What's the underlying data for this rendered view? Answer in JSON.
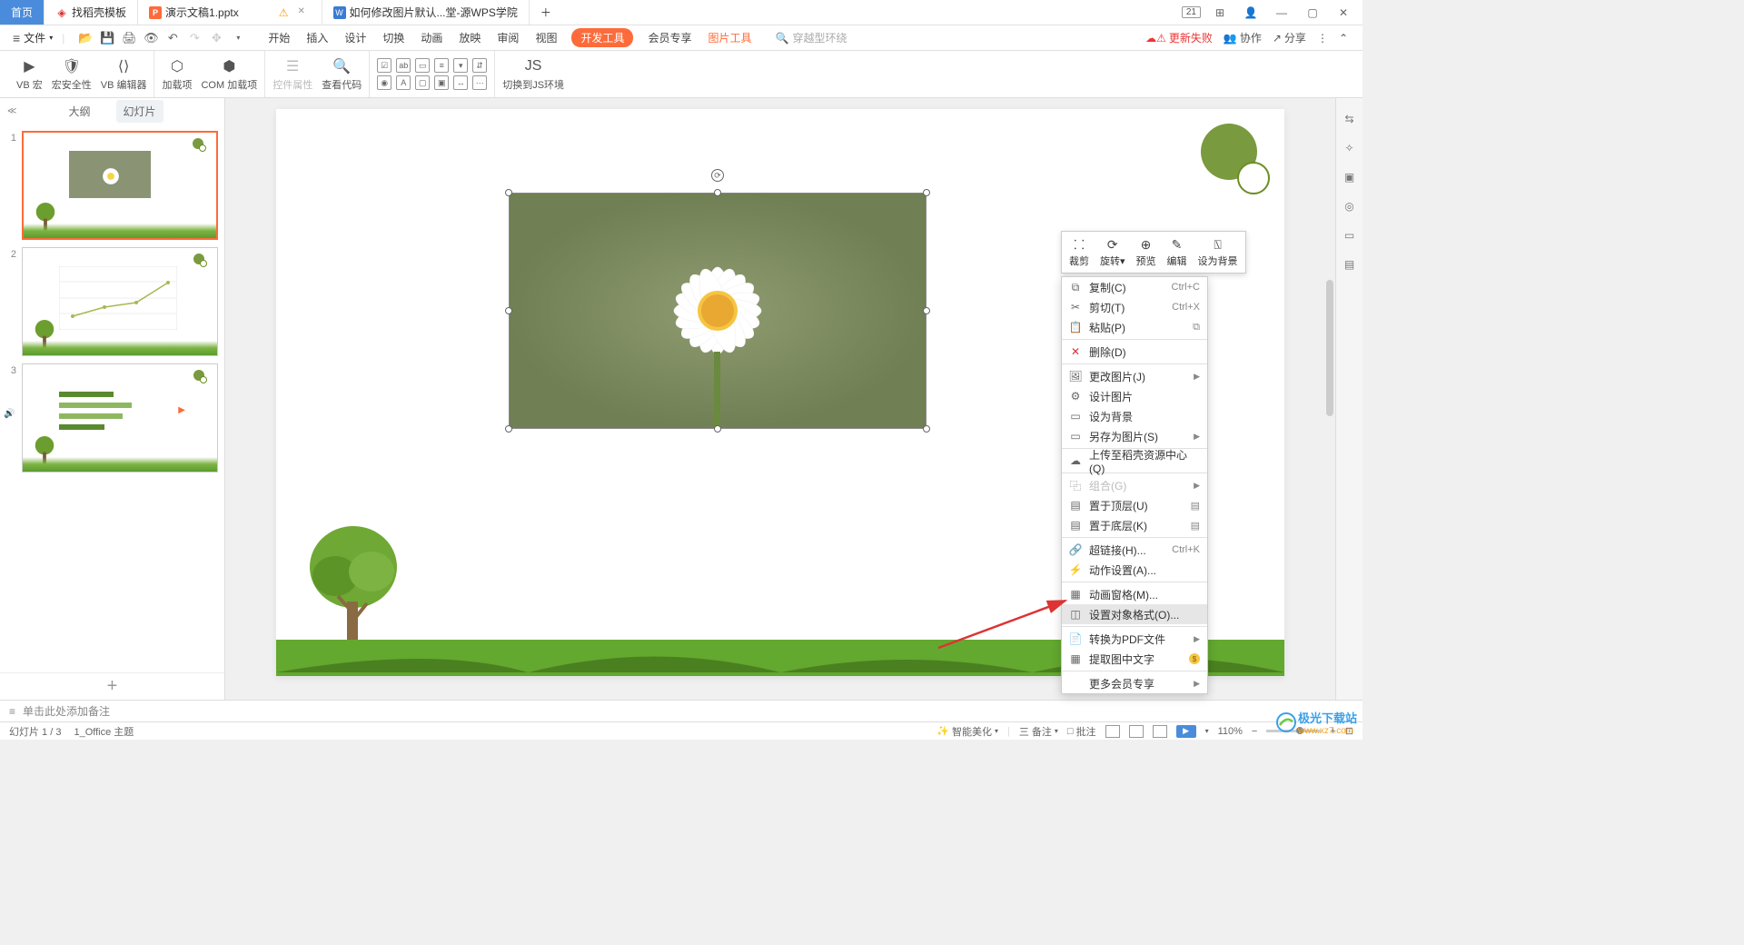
{
  "titleBar": {
    "home": "首页",
    "tabs": [
      {
        "icon": "🧧",
        "iconColor": "#d33",
        "label": "找稻壳模板"
      },
      {
        "icon": "P",
        "iconColor": "#fd6b3a",
        "label": "演示文稿1.pptx",
        "active": true,
        "warning": true
      },
      {
        "icon": "W",
        "iconColor": "#3a7bd5",
        "label": "如何修改图片默认...堂-源WPS学院"
      }
    ],
    "badge": "21"
  },
  "menuBar": {
    "file": "文件",
    "tabs": [
      "开始",
      "插入",
      "设计",
      "切换",
      "动画",
      "放映",
      "审阅",
      "视图",
      "开发工具",
      "会员专享",
      "图片工具"
    ],
    "searchPlaceholder": "穿越型环绕",
    "right": {
      "updateFail": "更新失败",
      "collab": "协作",
      "share": "分享"
    }
  },
  "ribbon": {
    "vbMacro": "VB 宏",
    "macroSecurity": "宏安全性",
    "vbEditor": "VB 编辑器",
    "addin": "加载项",
    "comAddin": "COM 加载项",
    "ctrlProps": "控件属性",
    "viewCode": "查看代码",
    "jsEnv": "切换到JS环境"
  },
  "leftPanel": {
    "outline": "大纲",
    "slides": "幻灯片",
    "slideNums": [
      "1",
      "2",
      "3"
    ]
  },
  "miniToolbar": {
    "crop": "裁剪",
    "rotate": "旋转",
    "preview": "预览",
    "edit": "编辑",
    "bg": "设为背景"
  },
  "contextMenu": {
    "items": [
      {
        "icon": "⧉",
        "label": "复制(C)",
        "shortcut": "Ctrl+C"
      },
      {
        "icon": "✂",
        "label": "剪切(T)",
        "shortcut": "Ctrl+X"
      },
      {
        "icon": "📋",
        "label": "粘贴(P)",
        "trail": "⧉"
      },
      {
        "sep": true
      },
      {
        "icon": "✕",
        "iconClass": "red",
        "label": "删除(D)"
      },
      {
        "sep": true
      },
      {
        "icon": "🖼",
        "label": "更改图片(J)",
        "arrow": true
      },
      {
        "icon": "⚙",
        "label": "设计图片"
      },
      {
        "icon": "▭",
        "label": "设为背景"
      },
      {
        "icon": "▭",
        "label": "另存为图片(S)",
        "arrow": true
      },
      {
        "sep": true
      },
      {
        "icon": "☁",
        "label": "上传至稻壳资源中心(Q)"
      },
      {
        "sep": true
      },
      {
        "icon": "⿻",
        "label": "组合(G)",
        "arrow": true,
        "disabled": true
      },
      {
        "icon": "▤",
        "label": "置于顶层(U)",
        "trail": "▤"
      },
      {
        "icon": "▤",
        "label": "置于底层(K)",
        "trail": "▤"
      },
      {
        "sep": true
      },
      {
        "icon": "🔗",
        "label": "超链接(H)...",
        "shortcut": "Ctrl+K"
      },
      {
        "icon": "⚡",
        "label": "动作设置(A)..."
      },
      {
        "sep": true
      },
      {
        "icon": "▦",
        "label": "动画窗格(M)..."
      },
      {
        "icon": "◫",
        "label": "设置对象格式(O)...",
        "hover": true
      },
      {
        "sep": true
      },
      {
        "icon": "📄",
        "label": "转换为PDF文件",
        "arrow": true
      },
      {
        "icon": "▦",
        "label": "提取图中文字",
        "premium": true
      },
      {
        "sep": true
      },
      {
        "label": "更多会员专享",
        "arrow": true
      }
    ]
  },
  "notesBar": {
    "placeholder": "单击此处添加备注"
  },
  "statusBar": {
    "slideCount": "幻灯片 1 / 3",
    "theme": "1_Office 主题",
    "beautify": "智能美化",
    "notes": "备注",
    "comments": "批注",
    "zoom": "110%"
  },
  "watermark": {
    "brand": "极光下载站",
    "url": "www.xz7.com"
  }
}
